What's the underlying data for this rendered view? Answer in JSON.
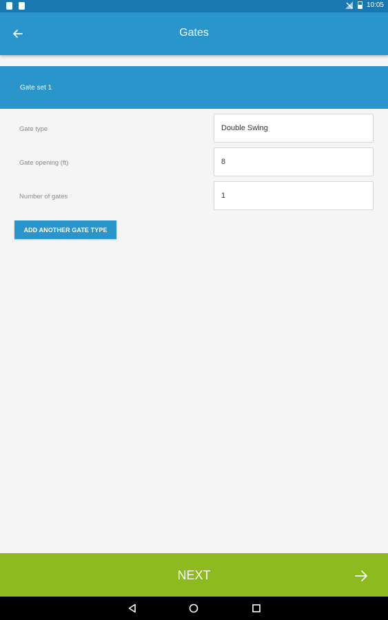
{
  "status_bar": {
    "time": "10:05"
  },
  "app_bar": {
    "title": "Gates"
  },
  "section": {
    "title": "Gate set 1"
  },
  "form": {
    "gate_type_label": "Gate type",
    "gate_type_value": "Double Swing",
    "gate_opening_label": "Gate opening (ft)",
    "gate_opening_value": "8",
    "number_of_gates_label": "Number of gates",
    "number_of_gates_value": "1"
  },
  "add_button_label": "ADD ANOTHER GATE TYPE",
  "next_button_label": "NEXT",
  "colors": {
    "primary": "#2a95cb",
    "accent": "#8cba1f",
    "status": "#1a78b0"
  }
}
